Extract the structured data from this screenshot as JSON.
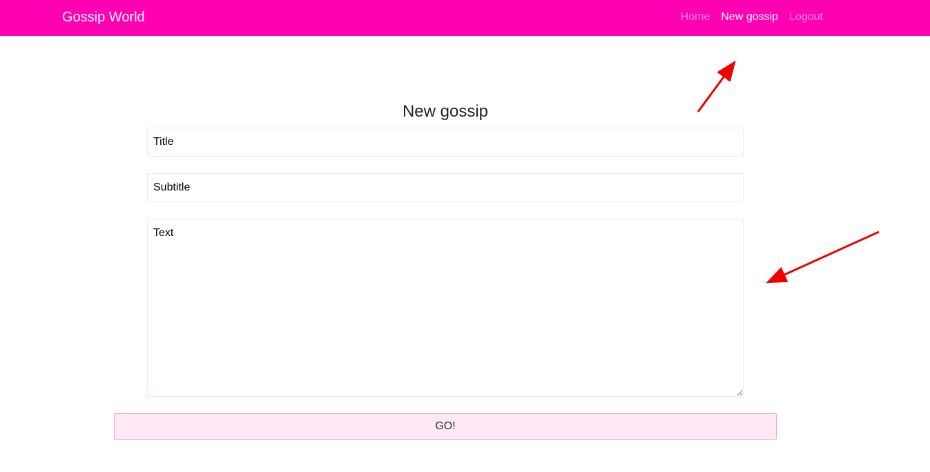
{
  "navbar": {
    "brand": "Gossip World",
    "links": [
      {
        "label": "Home",
        "active": false
      },
      {
        "label": "New gossip",
        "active": true
      },
      {
        "label": "Logout",
        "active": false
      }
    ],
    "color": "#ff00b2"
  },
  "form": {
    "heading": "New gossip",
    "title_value": "Title",
    "subtitle_value": "Subtitle",
    "text_value": "Text",
    "submit_label": "GO!"
  },
  "annotations": {
    "arrow_color": "#ee0000",
    "arrows": [
      "pointer-to-new-gossip-link",
      "pointer-to-text-area"
    ]
  }
}
